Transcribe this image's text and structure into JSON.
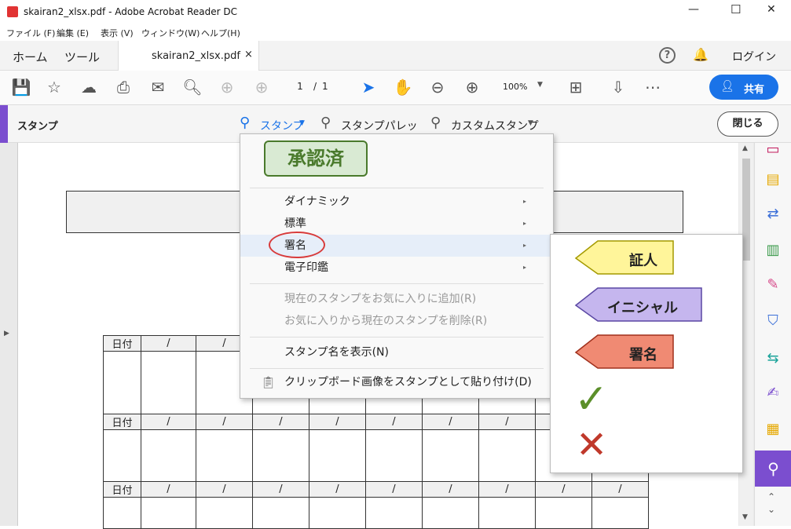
{
  "window": {
    "title": "skairan2_xlsx.pdf - Adobe Acrobat Reader DC",
    "controls": [
      "—",
      "☐",
      "✕"
    ]
  },
  "menubar": [
    "ファイル (F)",
    "編集 (E)",
    "表示 (V)",
    "ウィンドウ(W)",
    "ヘルプ(H)"
  ],
  "tabs": {
    "home": "ホーム",
    "tools": "ツール",
    "doc": "skairan2_xlsx.pdf",
    "doc_close": "×",
    "login": "ログイン",
    "help_icon": "?",
    "bell_icon": "🔔"
  },
  "toolbar": {
    "page_current": "1",
    "page_sep": "/",
    "page_total": "1",
    "zoom": "100%",
    "share_label": "共有"
  },
  "stampbar": {
    "title": "スタンプ",
    "stamp_label": "スタンプ",
    "palette_label": "スタンプパレット",
    "custom_label": "カスタムスタンプ",
    "close_label": "閉じる"
  },
  "menu": {
    "preview_stamp": "承認済",
    "items": [
      {
        "label": "ダイナミック",
        "arrow": "▸"
      },
      {
        "label": "標準",
        "arrow": "▸"
      },
      {
        "label": "署名",
        "arrow": "▸"
      },
      {
        "label": "電子印鑑",
        "arrow": "▸"
      }
    ],
    "disabled_items": [
      "現在のスタンプをお気に入りに追加(R)",
      "お気に入りから現在のスタンプを削除(R)"
    ],
    "show_name": "スタンプ名を表示(N)",
    "clipboard": "クリップボード画像をスタンプとして貼り付け(D)"
  },
  "submenu": {
    "stamps": [
      "証人",
      "イニシャル",
      "署名"
    ],
    "check_mark": "✓",
    "cross_mark": "✕",
    "colors": {
      "witness": "#fff59a",
      "initial": "#c5b6ee",
      "sign": "#f08a73"
    }
  },
  "table": {
    "date_label": "日付",
    "slash": "/"
  },
  "colors": {
    "accent": "#1a73e8",
    "stamp_green": "#4a7a2c",
    "sidebar_purple": "#7b4ecf"
  }
}
